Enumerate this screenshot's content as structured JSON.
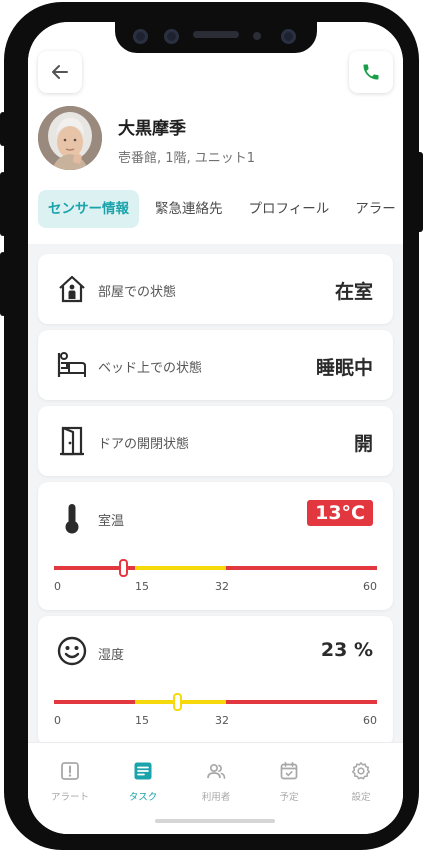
{
  "header": {
    "back_icon": "arrow-left-icon",
    "call_icon": "phone-icon",
    "resident_name": "大黒摩季",
    "address": "壱番館, 1階, ユニット1"
  },
  "tabs": [
    {
      "label": "センサー情報",
      "active": true
    },
    {
      "label": "緊急連絡先",
      "active": false
    },
    {
      "label": "プロフィール",
      "active": false
    },
    {
      "label": "アラー",
      "active": false
    }
  ],
  "sensors": {
    "room": {
      "icon": "house-person-icon",
      "label": "部屋での状態",
      "value": "在室"
    },
    "bed": {
      "icon": "bed-icon",
      "label": "ベッド上での状態",
      "value": "睡眠中"
    },
    "door": {
      "icon": "door-icon",
      "label": "ドアの開閉状態",
      "value": "開"
    },
    "temperature": {
      "icon": "thermometer-icon",
      "label": "室温",
      "value": "13°C",
      "reading": 13,
      "min": 0,
      "max": 60,
      "ticks": [
        "0",
        "15",
        "32",
        "60"
      ],
      "normal_range": [
        15,
        32
      ],
      "alert_color": "#e2373f",
      "normal_color": "#f5d90a"
    },
    "humidity": {
      "icon": "smile-face-icon",
      "label": "湿度",
      "value": "23 %",
      "reading": 23,
      "min": 0,
      "max": 60,
      "ticks": [
        "0",
        "15",
        "32",
        "60"
      ],
      "normal_range": [
        15,
        32
      ],
      "alert_color": "#e2373f",
      "normal_color": "#f5d90a"
    }
  },
  "bottom_nav": [
    {
      "icon": "alert-icon",
      "label": "アラート",
      "active": false
    },
    {
      "icon": "task-list-icon",
      "label": "タスク",
      "active": true
    },
    {
      "icon": "users-icon",
      "label": "利用者",
      "active": false
    },
    {
      "icon": "calendar-icon",
      "label": "予定",
      "active": false
    },
    {
      "icon": "gear-icon",
      "label": "設定",
      "active": false
    }
  ],
  "colors": {
    "accent": "#1aa3aa",
    "call_green": "#1a9e4a",
    "alert_red": "#e2373f"
  }
}
